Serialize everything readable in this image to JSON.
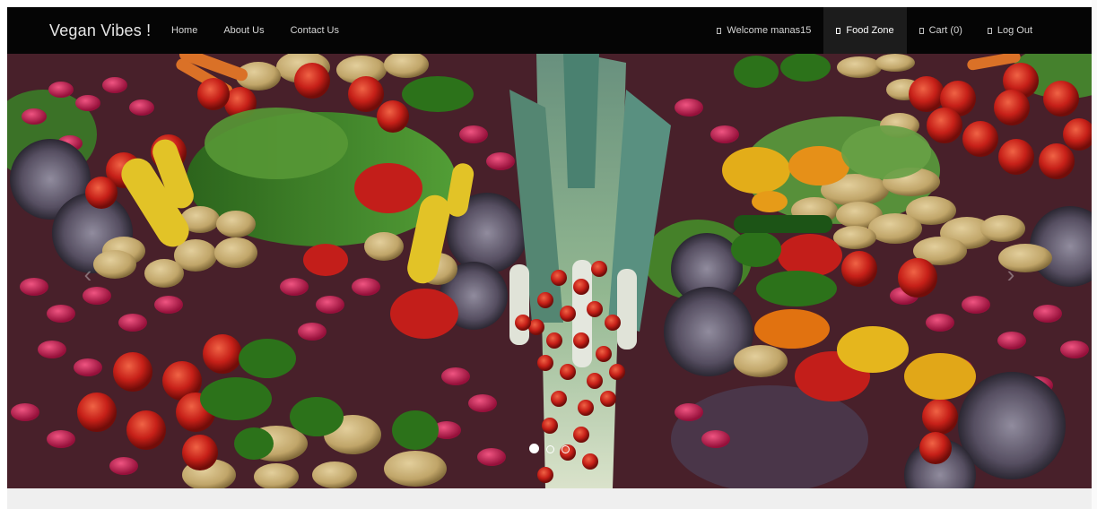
{
  "brand": "Vegan Vibes !",
  "nav_left": [
    {
      "label": "Home"
    },
    {
      "label": "About Us"
    },
    {
      "label": "Contact Us"
    }
  ],
  "nav_right": [
    {
      "label": "Welcome manas15",
      "icon": "user-icon"
    },
    {
      "label": "Food Zone",
      "icon": "food-icon",
      "active": true
    },
    {
      "label": "Cart (0)",
      "icon": "cart-icon"
    },
    {
      "label": "Log Out",
      "icon": "logout-icon"
    }
  ],
  "carousel": {
    "slides": 3,
    "active_slide": 1,
    "image": "assorted-vegetables-photo"
  },
  "colors": {
    "navbar": "#050505",
    "nav_text": "#d6d6d6",
    "active_nav_bg": "#1c1c1c"
  }
}
